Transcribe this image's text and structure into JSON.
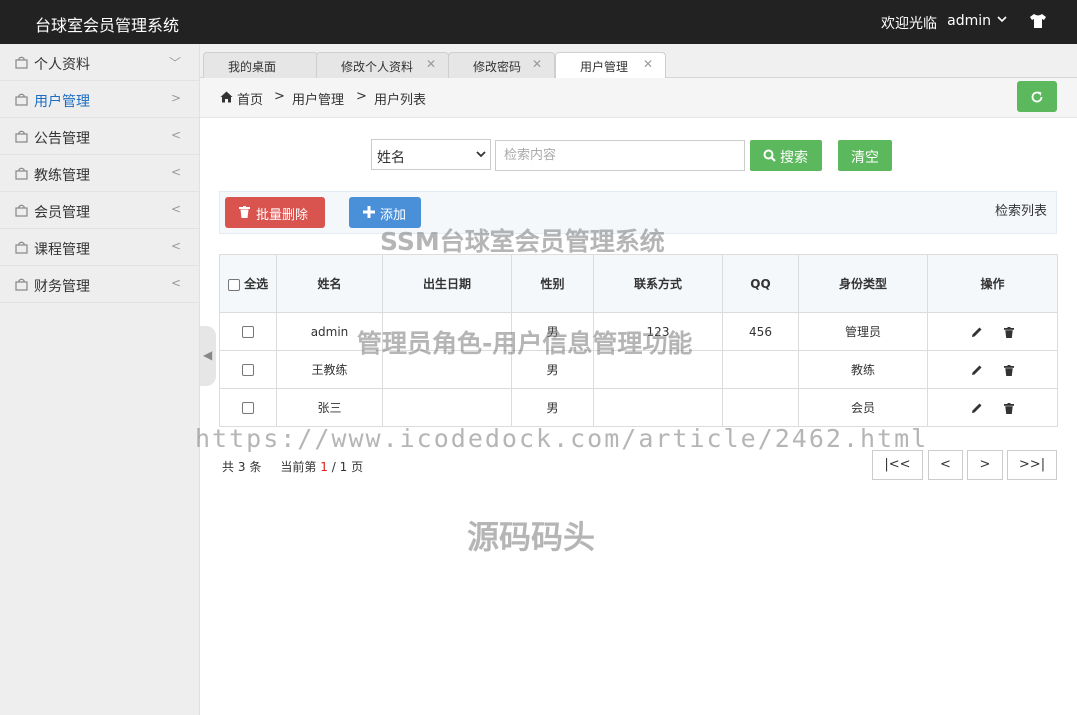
{
  "header": {
    "title": "台球室会员管理系统",
    "welcome": "欢迎光临",
    "username": "admin"
  },
  "sidebar": {
    "items": [
      {
        "label": "个人资料",
        "arrow": "﹀"
      },
      {
        "label": "用户管理",
        "arrow": ">"
      },
      {
        "label": "公告管理",
        "arrow": "<"
      },
      {
        "label": "教练管理",
        "arrow": "<"
      },
      {
        "label": "会员管理",
        "arrow": "<"
      },
      {
        "label": "课程管理",
        "arrow": "<"
      },
      {
        "label": "财务管理",
        "arrow": "<"
      }
    ],
    "active_index": 1
  },
  "tabs": [
    {
      "label": "我的桌面",
      "closable": false
    },
    {
      "label": "修改个人资料",
      "closable": true
    },
    {
      "label": "修改密码",
      "closable": true
    },
    {
      "label": "用户管理",
      "closable": true,
      "active": true
    }
  ],
  "breadcrumb": {
    "home": "首页",
    "sep": ">",
    "level1": "用户管理",
    "level2": "用户列表"
  },
  "search": {
    "field_selected": "姓名",
    "placeholder": "检索内容",
    "search_label": "搜索",
    "clear_label": "清空"
  },
  "actions": {
    "batch_delete": "批量删除",
    "add": "添加",
    "list_title": "检索列表"
  },
  "table": {
    "select_all": "全选",
    "columns": [
      "姓名",
      "出生日期",
      "性别",
      "联系方式",
      "QQ",
      "身份类型",
      "操作"
    ],
    "rows": [
      {
        "name": "admin",
        "birth": "",
        "gender": "男",
        "contact": "123",
        "qq": "456",
        "type": "管理员"
      },
      {
        "name": "王教练",
        "birth": "",
        "gender": "男",
        "contact": "",
        "qq": "",
        "type": "教练"
      },
      {
        "name": "张三",
        "birth": "",
        "gender": "男",
        "contact": "",
        "qq": "",
        "type": "会员"
      }
    ]
  },
  "pagination": {
    "total_prefix": "共",
    "total": "3",
    "total_suffix": "条",
    "current_prefix": "当前第",
    "current": "1",
    "slash": "/",
    "pages": "1",
    "pages_suffix": "页",
    "first": "|<<",
    "prev": "<",
    "next": ">",
    "last": ">>|"
  },
  "watermarks": {
    "line1": "SSM台球室会员管理系统",
    "line2": "管理员角色-用户信息管理功能",
    "line3": "https://www.icodedock.com/article/2462.html",
    "line4": "源码码头"
  },
  "colors": {
    "header_bg": "#222222",
    "success": "#5cb85c",
    "danger": "#d9534f",
    "primary": "#4a90d9",
    "active_link": "#1c6dc2"
  }
}
